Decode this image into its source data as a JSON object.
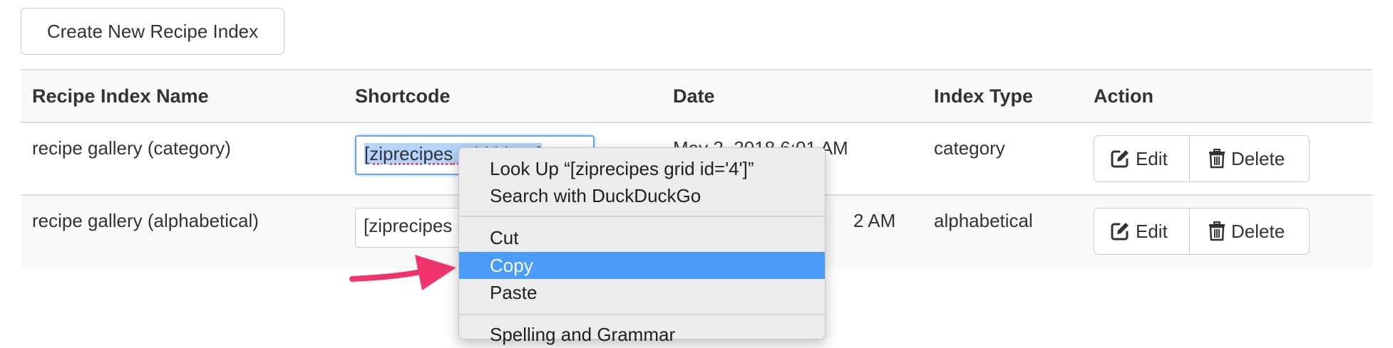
{
  "toolbar": {
    "create_label": "Create New Recipe Index"
  },
  "table": {
    "headers": [
      "Recipe Index Name",
      "Shortcode",
      "Date",
      "Index Type",
      "Action"
    ],
    "rows": [
      {
        "name": "recipe gallery (category)",
        "shortcode": "[ziprecipes",
        "shortcode_tail": " grid id='4']",
        "date": "May 2, 2018 6:01 AM",
        "type": "category",
        "edit": "Edit",
        "delete": "Delete"
      },
      {
        "name": "recipe gallery (alphabetical)",
        "shortcode": "[ziprecipes",
        "date": "2 AM",
        "type": "alphabetical",
        "edit": "Edit",
        "delete": "Delete"
      }
    ]
  },
  "context_menu": {
    "items": [
      "Look Up “[ziprecipes grid id='4']”",
      "Search with DuckDuckGo",
      "Cut",
      "Copy",
      "Paste",
      "Spelling and Grammar"
    ],
    "active_index": 3
  },
  "colors": {
    "menu_highlight": "#4a9bfa",
    "arrow": "#f0336b",
    "selection": "#b3d4fc"
  },
  "icons": {
    "edit": "pencil-square-icon",
    "delete": "trash-icon",
    "annotation": "pointer-arrow-icon"
  }
}
